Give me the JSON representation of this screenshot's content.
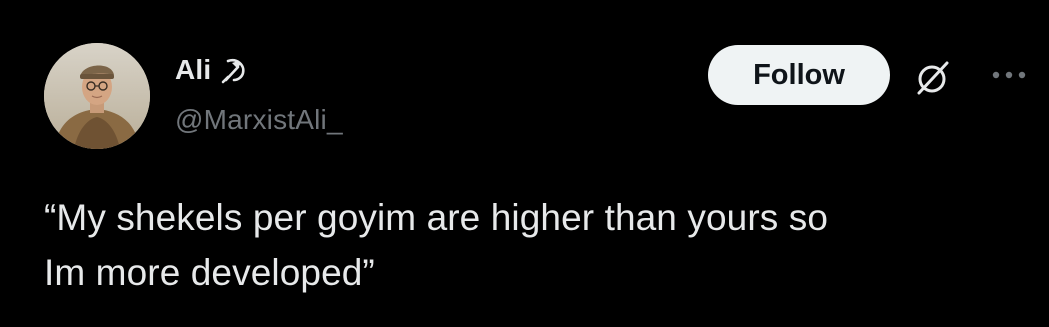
{
  "author": {
    "display_name": "Ali",
    "badge_icon": "hammer-and-sickle-icon",
    "handle": "@MarxistAli_"
  },
  "actions": {
    "follow_label": "Follow",
    "grok_icon": "grok-icon",
    "more_icon": "more-horizontal-icon"
  },
  "tweet": {
    "text_lines": [
      "“My shekels per goyim are higher than yours so",
      "Im more developed”"
    ]
  },
  "colors": {
    "background": "#000000",
    "primary_text": "#e7e9ea",
    "secondary_text": "#71767b",
    "follow_bg": "#eff3f4",
    "follow_text": "#0f1419"
  }
}
